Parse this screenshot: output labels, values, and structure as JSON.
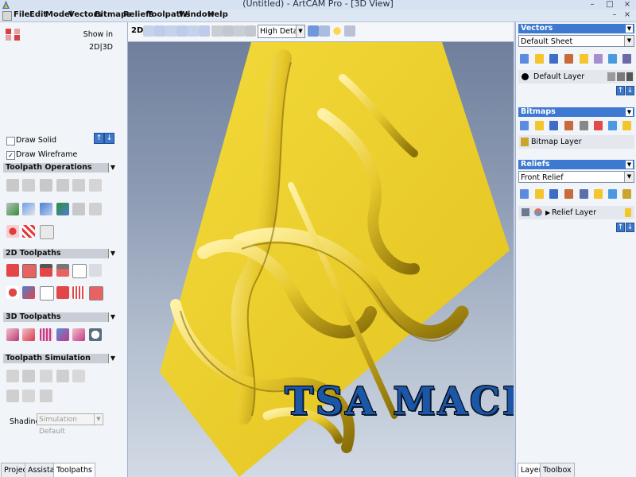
{
  "window": {
    "title": "(Untitled) - ArtCAM Pro - [3D View]"
  },
  "menu": {
    "items": [
      "File",
      "Edit",
      "Model",
      "Vectors",
      "Bitmaps",
      "Reliefs",
      "Toolpaths",
      "Window",
      "Help"
    ]
  },
  "left_panel": {
    "show_in_label": "Show in",
    "show_in_value": "2D|3D",
    "draw_solid": {
      "label": "Draw Solid",
      "checked": false
    },
    "draw_wireframe": {
      "label": "Draw Wireframe",
      "checked": true
    },
    "sections": {
      "toolpath_operations": "Toolpath Operations",
      "toolpaths_2d": "2D Toolpaths",
      "toolpaths_3d": "3D Toolpaths",
      "toolpath_simulation": "Toolpath Simulation"
    },
    "shading": {
      "label": "Shading",
      "value": "Simulation Default"
    },
    "tabs": [
      "Project",
      "Assistant",
      "Toolpaths"
    ],
    "active_tab": "Toolpaths"
  },
  "view_toolbar": {
    "mode_label": "2D",
    "detail": "High Detail"
  },
  "view3d": {
    "watermark": "TSA MACHINE",
    "relief_color": "#f1d634",
    "watermark_color": "#1b56a7"
  },
  "right_panel": {
    "vectors": {
      "header": "Vectors",
      "sheet": "Default Sheet",
      "layer": "Default Layer"
    },
    "bitmaps": {
      "header": "Bitmaps",
      "layer": "Bitmap Layer"
    },
    "reliefs": {
      "header": "Reliefs",
      "relief": "Front Relief",
      "layer": "Relief Layer"
    },
    "tabs": [
      "Layers",
      "Toolbox"
    ],
    "active_tab": "Layers"
  },
  "colors": {
    "accent": "#3d78d1",
    "panel": "#f1f4f8",
    "titlebar": "#d6e1f1"
  }
}
